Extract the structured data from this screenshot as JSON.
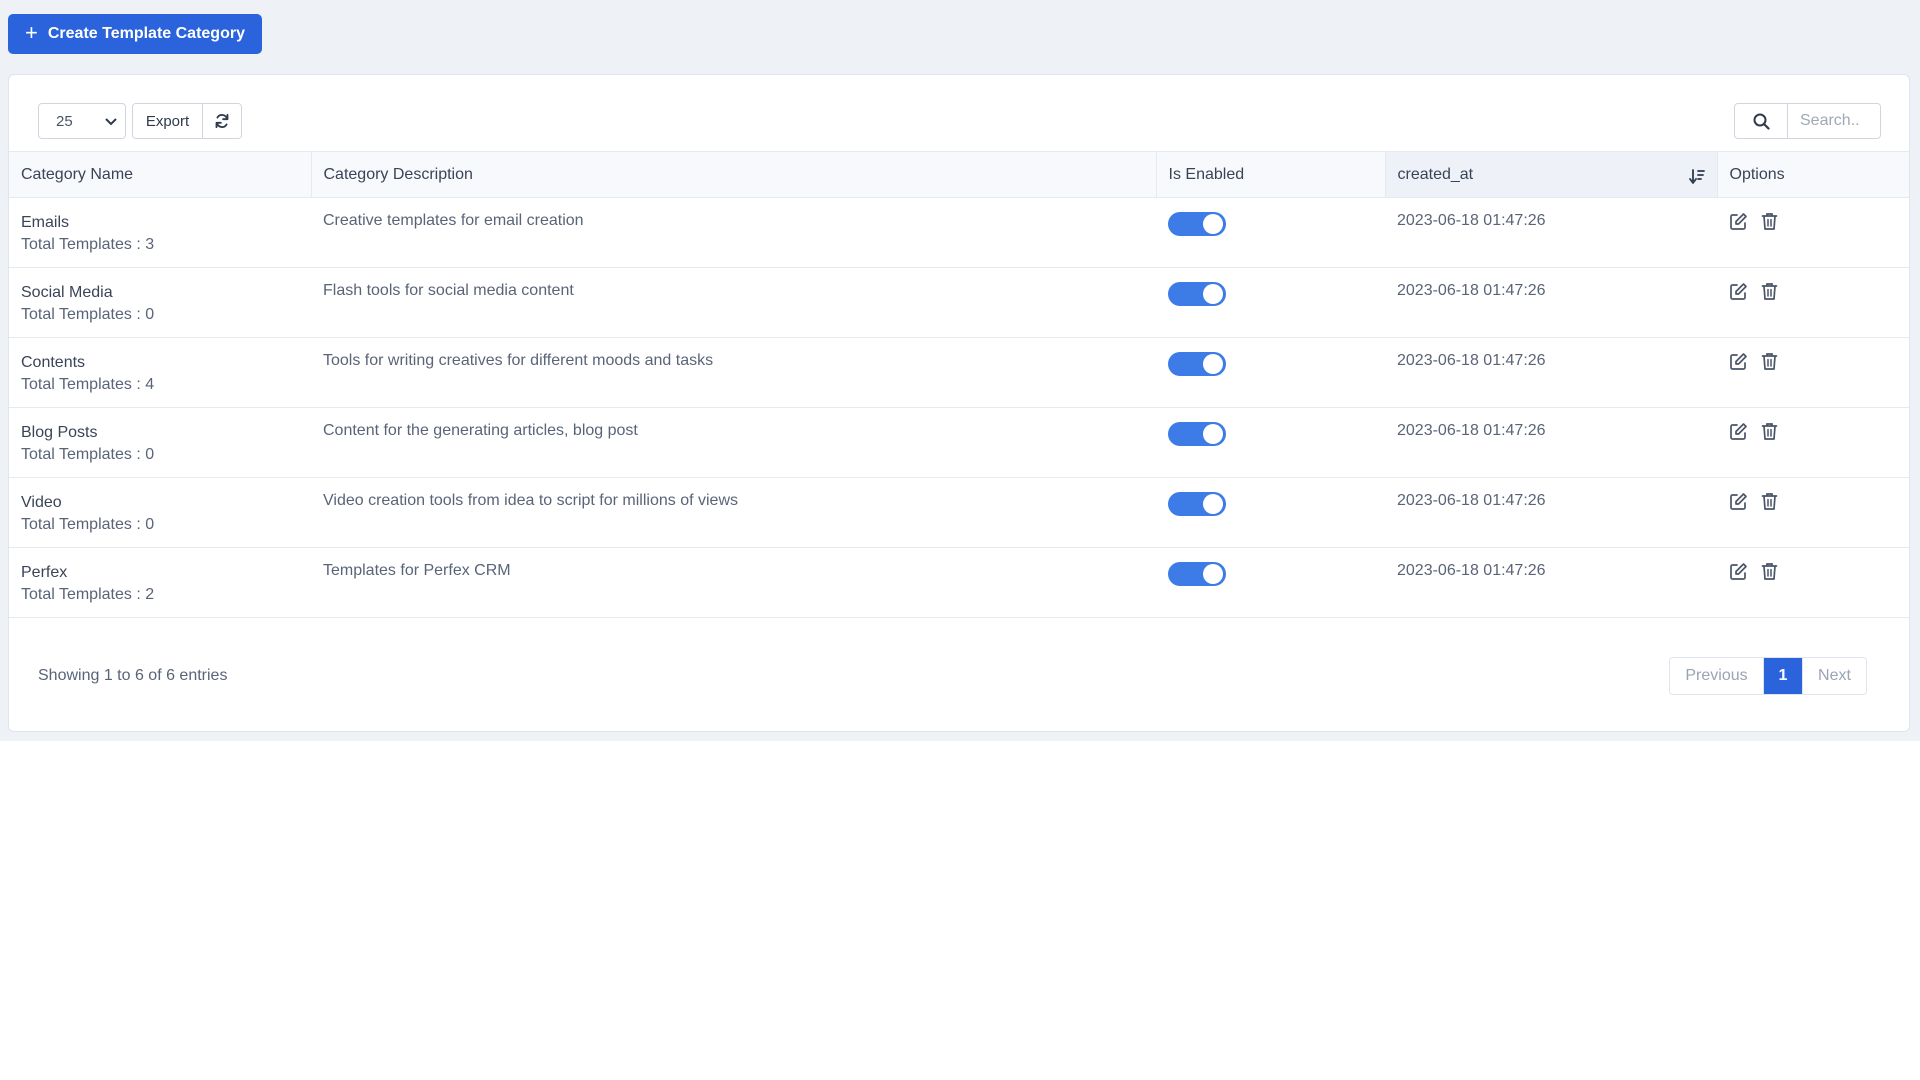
{
  "header": {
    "create_button_label": "Create Template Category"
  },
  "toolbar": {
    "page_size": "25",
    "export_label": "Export",
    "search_placeholder": "Search.."
  },
  "table": {
    "columns": [
      "Category Name",
      "Category Description",
      "Is Enabled",
      "created_at",
      "Options"
    ],
    "rows": [
      {
        "name": "Emails",
        "count": "Total Templates : 3",
        "description": "Creative templates for email creation",
        "enabled": true,
        "created_at": "2023-06-18 01:47:26"
      },
      {
        "name": "Social Media",
        "count": "Total Templates : 0",
        "description": "Flash tools for social media content",
        "enabled": true,
        "created_at": "2023-06-18 01:47:26"
      },
      {
        "name": "Contents",
        "count": "Total Templates : 4",
        "description": "Tools for writing creatives for different moods and tasks",
        "enabled": true,
        "created_at": "2023-06-18 01:47:26"
      },
      {
        "name": "Blog Posts",
        "count": "Total Templates : 0",
        "description": "Content for the generating articles, blog post",
        "enabled": true,
        "created_at": "2023-06-18 01:47:26"
      },
      {
        "name": "Video",
        "count": "Total Templates : 0",
        "description": "Video creation tools from idea to script for millions of views",
        "enabled": true,
        "created_at": "2023-06-18 01:47:26"
      },
      {
        "name": "Perfex",
        "count": "Total Templates : 2",
        "description": "Templates for Perfex CRM",
        "enabled": true,
        "created_at": "2023-06-18 01:47:26"
      }
    ]
  },
  "footer": {
    "info": "Showing 1 to 6 of 6 entries",
    "prev_label": "Previous",
    "current_page": "1",
    "next_label": "Next"
  },
  "colors": {
    "primary": "#2b63dc",
    "toggle_on": "#3d7be6",
    "page_bg": "#eef2f7"
  }
}
